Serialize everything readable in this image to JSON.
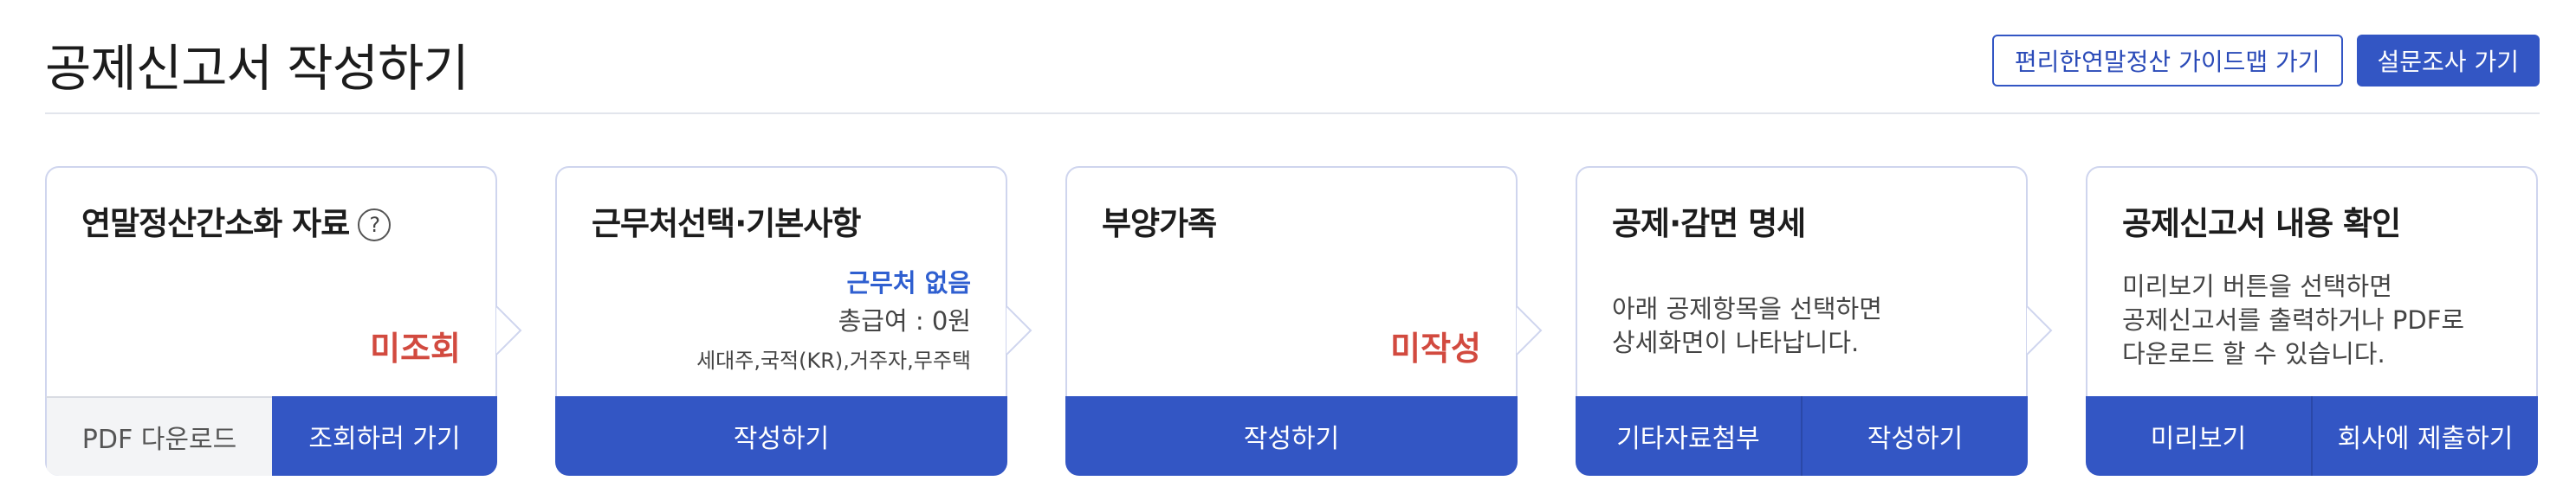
{
  "header": {
    "title": "공제신고서 작성하기",
    "guide_button": "편리한연말정산 가이드맵 가기",
    "survey_button": "설문조사 가기"
  },
  "cards": [
    {
      "title": "연말정산간소화 자료",
      "help_icon": "?",
      "status": "미조회",
      "buttons": [
        "PDF 다운로드",
        "조회하러 가기"
      ]
    },
    {
      "title": "근무처선택·기본사항",
      "workplace_status": "근무처 없음",
      "total_pay": "총급여 : 0원",
      "details": "세대주,국적(KR),거주자,무주택",
      "buttons": [
        "작성하기"
      ]
    },
    {
      "title": "부양가족",
      "status": "미작성",
      "buttons": [
        "작성하기"
      ]
    },
    {
      "title": "공제·감면 명세",
      "desc_line1": "아래 공제항목을 선택하면",
      "desc_line2": "상세화면이 나타납니다.",
      "buttons": [
        "기타자료첨부",
        "작성하기"
      ]
    },
    {
      "title": "공제신고서 내용 확인",
      "desc_line1": "미리보기 버튼을 선택하면",
      "desc_line2": "공제신고서를 출력하거나 PDF로",
      "desc_line3": "다운로드 할 수 있습니다.",
      "buttons": [
        "미리보기",
        "회사에 제출하기"
      ]
    }
  ],
  "colors": {
    "primary": "#3356c4",
    "status_red": "#d24a3f",
    "status_blue": "#2f5fd0",
    "card_border": "#cfd5ee"
  },
  "icons": [
    "help-icon",
    "step-arrow-icon"
  ]
}
